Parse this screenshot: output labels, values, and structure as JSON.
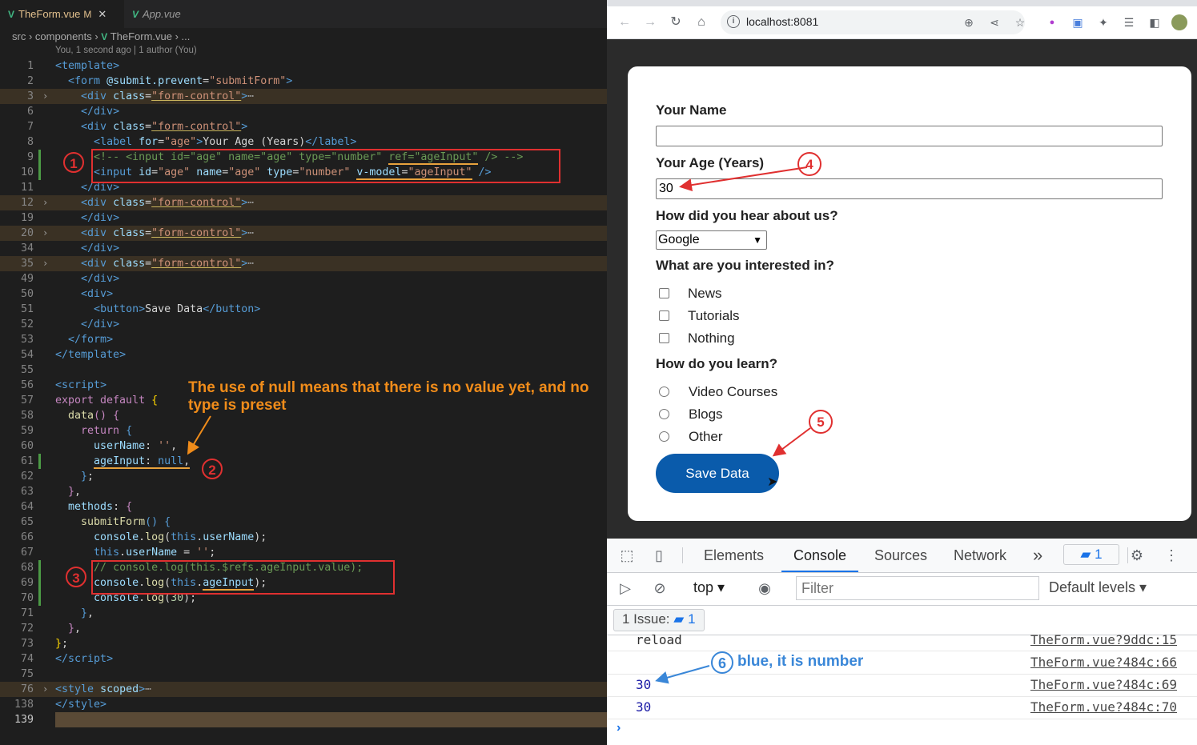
{
  "editor": {
    "tabs": [
      {
        "label": "TheForm.vue",
        "modified": "M"
      },
      {
        "label": "App.vue"
      }
    ],
    "breadcrumb": "src › components ›",
    "breadcrumb_file": "TheForm.vue › ...",
    "blame": "You, 1 second ago | 1 author (You)",
    "lines": [
      {
        "n": "1"
      },
      {
        "n": "2"
      },
      {
        "n": "3"
      },
      {
        "n": "6"
      },
      {
        "n": "7"
      },
      {
        "n": "8"
      },
      {
        "n": "9"
      },
      {
        "n": "10"
      },
      {
        "n": "11"
      },
      {
        "n": "12"
      },
      {
        "n": "19"
      },
      {
        "n": "20"
      },
      {
        "n": "34"
      },
      {
        "n": "35"
      },
      {
        "n": "49"
      },
      {
        "n": "50"
      },
      {
        "n": "51"
      },
      {
        "n": "52"
      },
      {
        "n": "53"
      },
      {
        "n": "54"
      },
      {
        "n": "55"
      },
      {
        "n": "56"
      },
      {
        "n": "57"
      },
      {
        "n": "58"
      },
      {
        "n": "59"
      },
      {
        "n": "60"
      },
      {
        "n": "61"
      },
      {
        "n": "62"
      },
      {
        "n": "63"
      },
      {
        "n": "64"
      },
      {
        "n": "65"
      },
      {
        "n": "66"
      },
      {
        "n": "67"
      },
      {
        "n": "68"
      },
      {
        "n": "69"
      },
      {
        "n": "70"
      },
      {
        "n": "71"
      },
      {
        "n": "72"
      },
      {
        "n": "73"
      },
      {
        "n": "74"
      },
      {
        "n": "75"
      },
      {
        "n": "76"
      },
      {
        "n": "138"
      },
      {
        "n": "139"
      }
    ],
    "code": {
      "template_open": "template",
      "form_tag": "form",
      "submit_attr": "@submit.prevent",
      "submit_val": "\"submitForm\"",
      "div": "div",
      "class_attr": "class",
      "form_control": "\"form-control\"",
      "ellipsis": "⋯",
      "label": "label",
      "for_attr": "for",
      "age_str": "\"age\"",
      "label_text": "Your Age (Years)",
      "comment_line": "<!-- <input id=\"age\" name=\"age\" type=\"number\" ",
      "comment_ref": "ref=\"ageInput\"",
      "comment_end": " /> -->",
      "input": "input",
      "id_attr": "id",
      "name_attr": "name",
      "type_attr": "type",
      "number_str": "\"number\"",
      "vmodel_attr": "v-model",
      "ageinput_str": "\"ageInput\"",
      "button": "button",
      "button_text": "Save Data",
      "script": "script",
      "export_default": "export default",
      "data_fn": "data",
      "return_kw": "return",
      "username_key": "userName",
      "empty_str": "''",
      "ageinput_key": "ageInput",
      "null_kw": "null",
      "methods_key": "methods",
      "submitform_fn": "submitForm",
      "console": "console",
      "log": "log",
      "this_kw": "this",
      "username_prop": "userName",
      "comment_log": "// console.log(this.$refs.ageInput.value);",
      "ageinput_prop": "ageInput",
      "num_30": "30",
      "style": "style",
      "scoped": "scoped"
    },
    "annotations": {
      "c1": "1",
      "c2": "2",
      "c3": "3",
      "null_note": "The use of null means that there is no value yet, and no type is preset"
    }
  },
  "browser": {
    "url": "localhost:8081",
    "form": {
      "name_label": "Your Name",
      "name_value": "",
      "age_label": "Your Age (Years)",
      "age_value": "30",
      "referrer_label": "How did you hear about us?",
      "referrer_value": "Google",
      "interest_label": "What are you interested in?",
      "interests": [
        "News",
        "Tutorials",
        "Nothing"
      ],
      "learn_label": "How do you learn?",
      "learn_options": [
        "Video Courses",
        "Blogs",
        "Other"
      ],
      "save_label": "Save Data"
    },
    "annotations": {
      "c4": "4",
      "c5": "5"
    }
  },
  "devtools": {
    "tabs": [
      "Elements",
      "Console",
      "Sources",
      "Network"
    ],
    "active_tab": "Console",
    "more": "»",
    "issues_count": "1",
    "context": "top ▾",
    "filter_placeholder": "Filter",
    "levels": "Default levels ▾",
    "issue_bar": "1 Issue:",
    "issue_count": "1",
    "console": [
      {
        "msg": "reload",
        "src": "TheForm.vue?9ddc:15"
      },
      {
        "msg": "",
        "src": "TheForm.vue?484c:66"
      },
      {
        "msg": "30",
        "src": "TheForm.vue?484c:69"
      },
      {
        "msg": "30",
        "src": "TheForm.vue?484c:70"
      }
    ],
    "prompt": "›",
    "annotations": {
      "c6": "6",
      "note": "blue, it is number"
    }
  }
}
